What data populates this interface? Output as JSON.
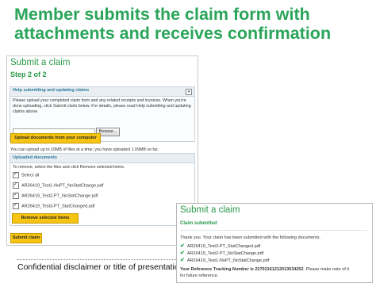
{
  "slide": {
    "title": "Member submits the claim form with attachments and receives confirmation",
    "footer": "Confidential disclaimer or title of presentation here, to"
  },
  "step_panel": {
    "title": "Submit a claim",
    "step": "Step 2 of 2",
    "help_title": "Help submitting and updating claims",
    "help_text": "Please upload your completed claim form and any related receipts and invoices. When you're done uploading, click Submit claim below. For details, please read Help submitting and updating claims above.",
    "browse_label": "Browse...",
    "upload_button": "Upload documents from your computer",
    "limit_text": "You can upload up to 10MB of files at a time; you have uploaded 1.09MB so far.",
    "uploaded_title": "Uploaded documents",
    "select_hint": "To remove, select the files and click Remove selected items.",
    "select_all": "Select all",
    "files": [
      "AR26419_Test1-NoPT_NoStatChange.pdf",
      "AR26419_Test2-PT_NoStatChange.pdf",
      "AR26419_Test3-PT_StatChanged.pdf"
    ],
    "remove_button": "Remove selected items",
    "submit_button": "Submit claim"
  },
  "confirm_panel": {
    "title": "Submit a claim",
    "status": "Claim submitted",
    "thanks": "Thank you. Your claim has been submitted with the following documents.",
    "documents": [
      "AR26419_Test3-PT_StatChanged.pdf",
      "AR26419_Test2-PT_NoStatChange.pdf",
      "AR26419_Test1-NoPT_NoStatChange.pdf"
    ],
    "ref_label": "Your Reference Tracking Number is",
    "ref_number": "22702161212013034252",
    "ref_note": ". Please make note of it",
    "ref_note2": "for future reference."
  },
  "colors": {
    "accent_green": "#2aa55a",
    "button_yellow": "#f6c412"
  }
}
